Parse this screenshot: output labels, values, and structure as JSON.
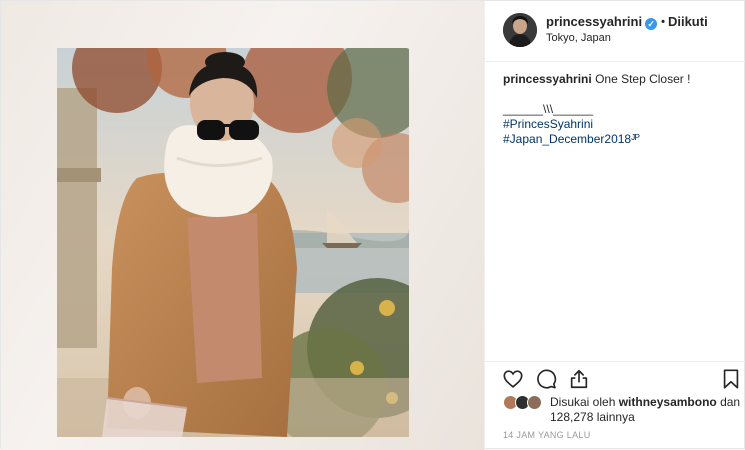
{
  "post": {
    "username": "princessyahrini",
    "follow_label": "Diikuti",
    "location": "Tokyo, Japan",
    "caption": {
      "username": "princessyahrini",
      "text": "One Step Closer !",
      "line2": "______\\\\\\______",
      "hashtags": [
        "#PrincesSyahrini",
        "#Japan_December2018ᴶᴾ"
      ]
    },
    "likes": {
      "prefix": "Disukai oleh",
      "liker": "withneysambono",
      "joiner": "dan",
      "count": "128,278 lainnya"
    },
    "timestamp": "14 JAM YANG LALU"
  },
  "icons": {
    "like": "heart-icon",
    "comment": "comment-icon",
    "share": "share-icon",
    "save": "bookmark-icon",
    "verified": "verified-badge-icon"
  },
  "colors": {
    "accent": "#3897f0",
    "hashtag": "#003569",
    "text": "#262626",
    "muted": "#999999"
  }
}
